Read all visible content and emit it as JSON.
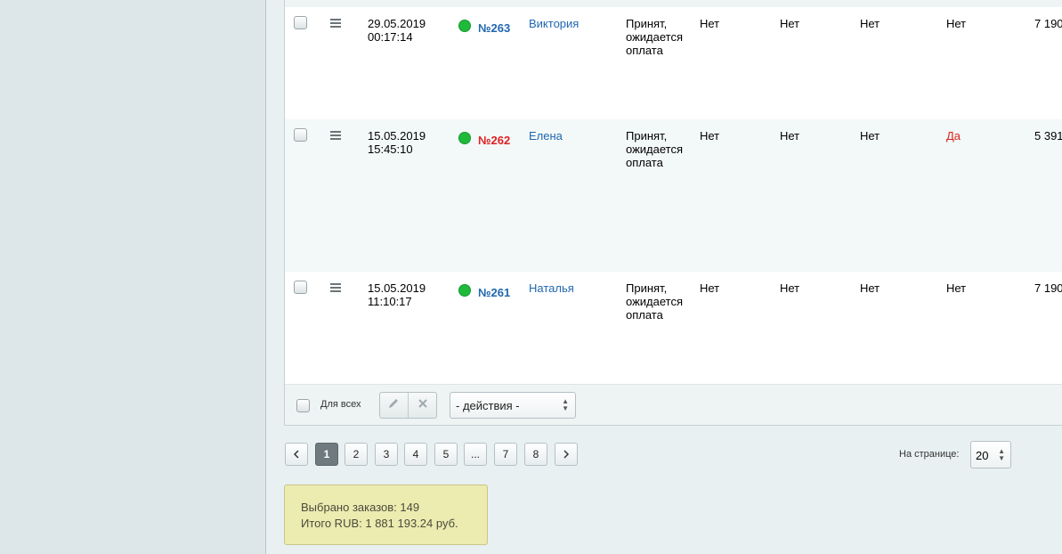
{
  "orders": [
    {
      "date": "29.05.2019",
      "time": "00:17:14",
      "number": "№263",
      "number_color": "#2067b0",
      "customer": "Виктория",
      "status_lines": [
        "Принят,",
        "ожидается",
        "оплата"
      ],
      "col1": "Нет",
      "col2": "Нет",
      "col3": "Нет",
      "col4": "Нет",
      "col4_highlight": false,
      "amount": "7 190"
    },
    {
      "date": "15.05.2019",
      "time": "15:45:10",
      "number": "№262",
      "number_color": "#e02020",
      "customer": "Елена",
      "status_lines": [
        "Принят,",
        "ожидается",
        "оплата"
      ],
      "col1": "Нет",
      "col2": "Нет",
      "col3": "Нет",
      "col4": "Да",
      "col4_highlight": true,
      "amount": "5 391"
    },
    {
      "date": "15.05.2019",
      "time": "11:10:17",
      "number": "№261",
      "number_color": "#2067b0",
      "customer": "Наталья",
      "status_lines": [
        "Принят,",
        "ожидается",
        "оплата"
      ],
      "col1": "Нет",
      "col2": "Нет",
      "col3": "Нет",
      "col4": "Нет",
      "col4_highlight": false,
      "amount": "7 190"
    }
  ],
  "footer": {
    "for_all_label": "Для всех",
    "edit_icon": "pencil-icon",
    "delete_icon": "close-icon",
    "actions_select": "- действия -"
  },
  "pagination": {
    "prev_icon": "chevron-left-icon",
    "next_icon": "chevron-right-icon",
    "pages": [
      "1",
      "2",
      "3",
      "4",
      "5",
      "...",
      "7",
      "8"
    ],
    "current": "1",
    "per_page_label": "На странице:",
    "per_page_value": "20"
  },
  "summary": {
    "selected_orders": "Выбрано заказов: 149",
    "total": "Итого RUB: 1 881 193.24 руб."
  }
}
